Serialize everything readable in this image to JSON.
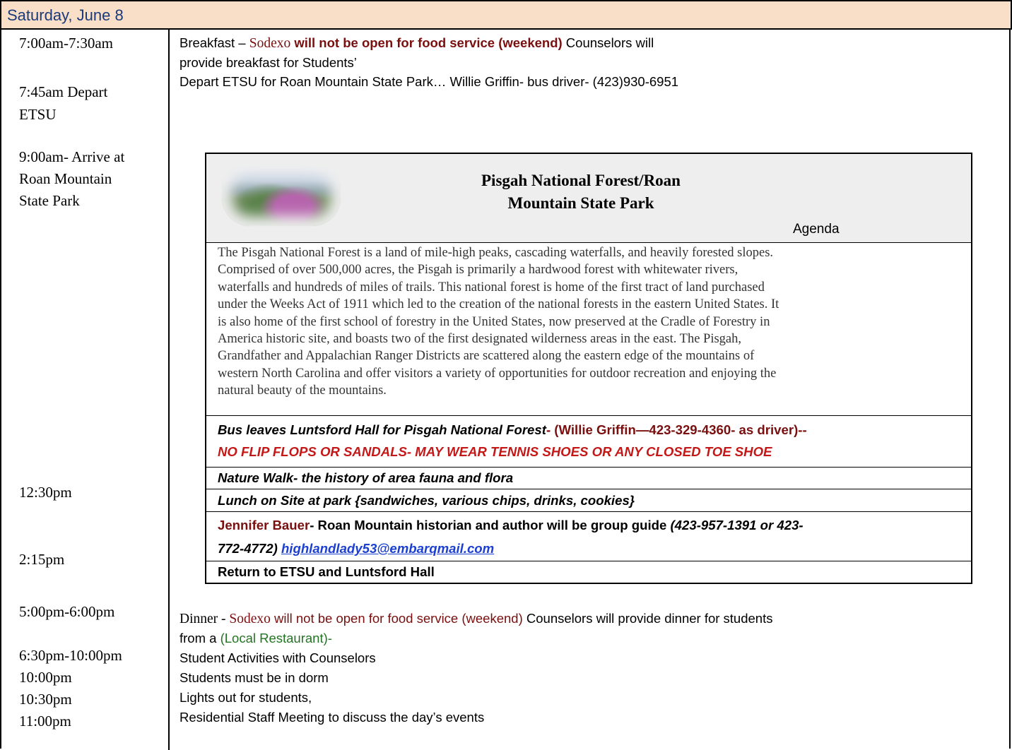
{
  "header": {
    "title": "Saturday, June 8"
  },
  "times": [
    "7:00am-7:30am",
    "7:45am Depart",
    "ETSU",
    "9:00am- Arrive at",
    "Roan Mountain",
    "State Park",
    "12:30pm",
    "2:15pm",
    "5:00pm-6:00pm",
    "6:30pm-10:00pm",
    "10:00pm",
    "10:30pm",
    "11:00pm"
  ],
  "morning": {
    "breakfast_prefix": "Breakfast – ",
    "sodexo": "Sodexo",
    "closed_bold": " will not be open for food service (weekend)",
    "counselors": " Counselors will",
    "line2": "provide breakfast for Students’",
    "line3": "Depart ETSU for Roan Mountain State Park… Willie Griffin- bus driver- (423)930-6951"
  },
  "agenda_box": {
    "title_line1": "Pisgah National Forest/Roan",
    "title_line2": "Mountain State Park",
    "agenda_label": "Agenda",
    "photo": "mountain-rhododendron-photo",
    "paragraph_lines": [
      "The Pisgah National Forest is a land of mile-high peaks, cascading waterfalls, and heavily forested slopes.",
      "Comprised of over 500,000 acres, the Pisgah is primarily a hardwood forest with whitewater rivers,",
      "waterfalls and hundreds of miles of trails. This national forest is home of the first tract of land purchased",
      "under the Weeks Act of 1911 which led to the creation of the national forests in the eastern United States. It",
      "is also home of the first school of forestry in the United States, now preserved at the Cradle of Forestry in",
      "America historic site, and boasts two of the first designated wilderness areas in the east. The Pisgah,",
      "Grandfather and Appalachian Ranger Districts are scattered along the eastern edge of the mountains of",
      "western North Carolina and offer visitors a variety of opportunities for outdoor recreation and enjoying the",
      "natural beauty of the mountains."
    ],
    "bus_text": "Bus leaves Luntsford Hall for Pisgah National Forest",
    "bus_driver": "- (Willie Griffin—423-329-4360- as driver)--",
    "shoes_warning": "NO FLIP FLOPS OR SANDALS- MAY WEAR TENNIS SHOES OR ANY CLOSED TOE SHOE",
    "nature_walk": "Nature Walk- the history of area fauna and flora",
    "lunch": "Lunch on Site at park {sandwiches, various chips, drinks, cookies}",
    "guide_name": "Jennifer Bauer",
    "guide_desc": "- Roan Mountain historian and author will be group guide ",
    "guide_phone1": "(423-957-1391 or 423-",
    "guide_phone2": "772-4772) ",
    "guide_email": "highlandlady53@embarqmail.com",
    "return": "Return to ETSU and Luntsford Hall"
  },
  "evening": {
    "dinner_prefix": "Dinner - ",
    "sodexo": "Sodexo",
    "closed": " will not be open for food service (weekend)",
    "counselors": " Counselors will provide dinner for students",
    "from": "from a ",
    "restaurant": "(Local Restaurant)-",
    "activities": "Student Activities with Counselors",
    "dorm": "Students must be in dorm",
    "lights": "Lights out for students,",
    "meeting": "Residential Staff Meeting to discuss the day’s events"
  },
  "colors": {
    "header_bg": "#fadfc8",
    "title_blue": "#1a3a7a",
    "dark_red": "#7a0f0f",
    "bright_red": "#c41818",
    "green": "#237523",
    "link_blue": "#1b3fd0"
  }
}
